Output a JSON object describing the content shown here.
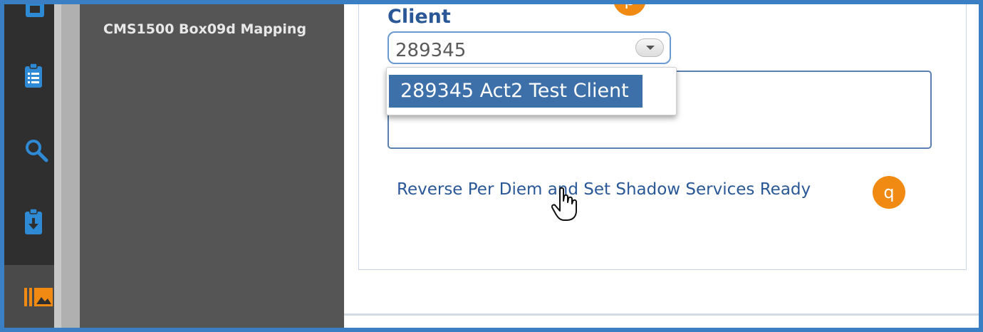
{
  "colors": {
    "accent": "#2a5896",
    "badge": "#f08a12",
    "selection": "#3d6fa8",
    "rail": "#2f2f2f",
    "submenu": "#555555"
  },
  "rail": {
    "items": [
      {
        "icon": "document-box-icon"
      },
      {
        "icon": "clipboard-list-icon"
      },
      {
        "icon": "search-icon"
      },
      {
        "icon": "clipboard-download-icon"
      },
      {
        "icon": "library-icon"
      }
    ]
  },
  "submenu": {
    "item_label": "CMS1500 Box09d Mapping"
  },
  "form": {
    "client_label": "Client",
    "badge_p": "p",
    "client_value": "289345",
    "dropdown_option": "289345 Act2 Test Client",
    "link_text": "Reverse Per Diem and Set Shadow Services Ready",
    "badge_q": "q"
  }
}
